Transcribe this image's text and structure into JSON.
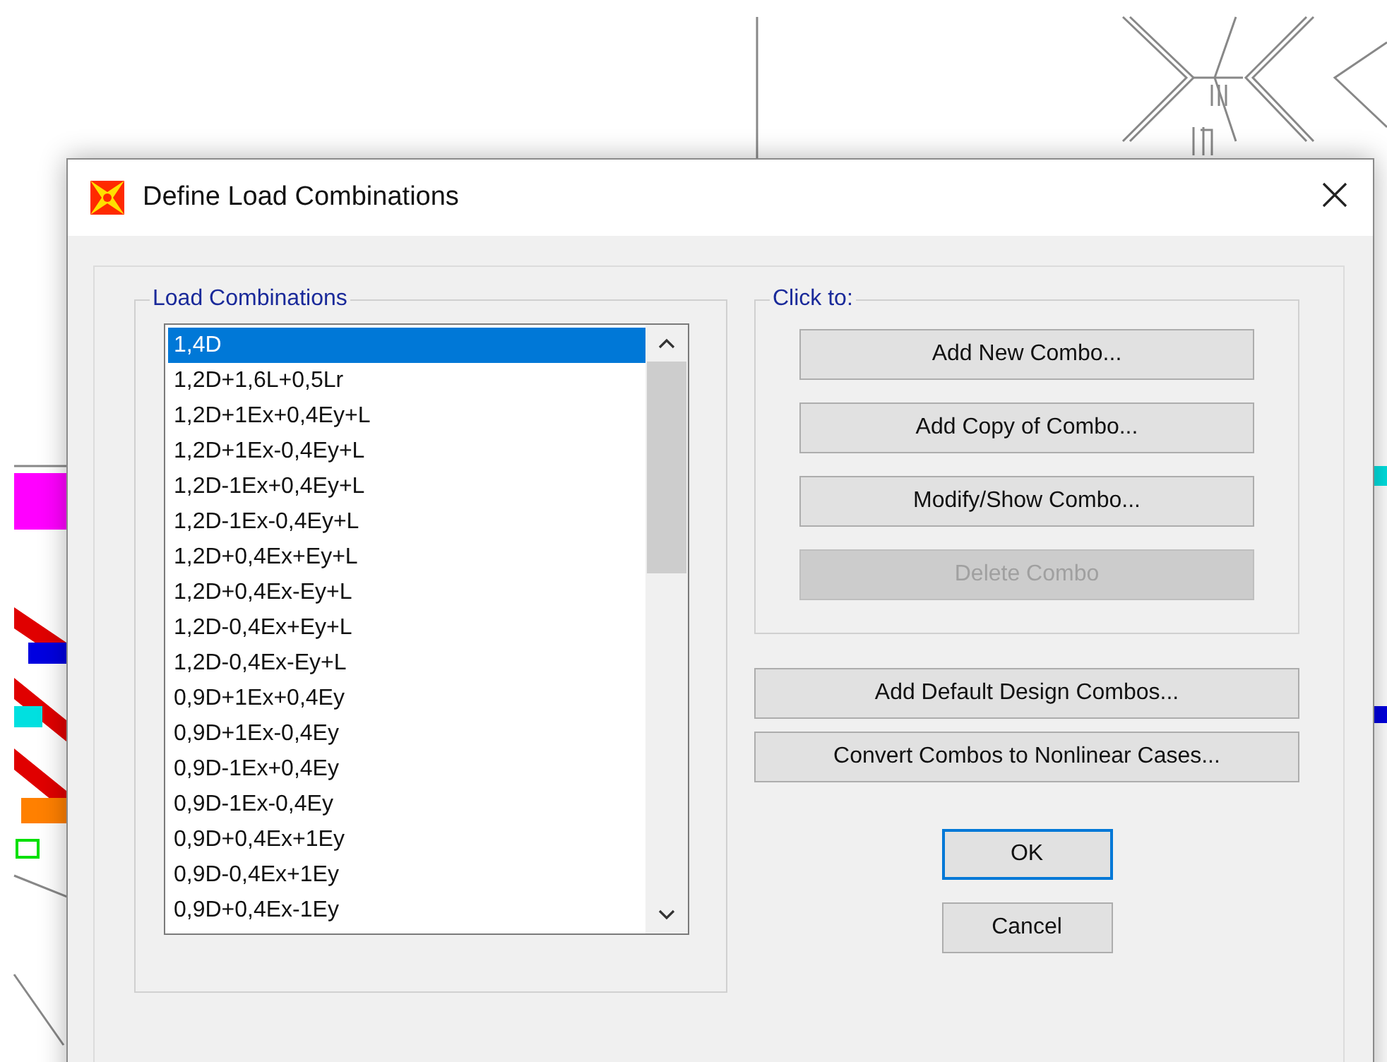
{
  "window": {
    "title": "Define Load Combinations"
  },
  "load_combinations": {
    "label": "Load Combinations",
    "items": [
      {
        "label": "1,4D",
        "selected": true
      },
      {
        "label": "1,2D+1,6L+0,5Lr",
        "selected": false
      },
      {
        "label": "1,2D+1Ex+0,4Ey+L",
        "selected": false
      },
      {
        "label": "1,2D+1Ex-0,4Ey+L",
        "selected": false
      },
      {
        "label": "1,2D-1Ex+0,4Ey+L",
        "selected": false
      },
      {
        "label": "1,2D-1Ex-0,4Ey+L",
        "selected": false
      },
      {
        "label": "1,2D+0,4Ex+Ey+L",
        "selected": false
      },
      {
        "label": "1,2D+0,4Ex-Ey+L",
        "selected": false
      },
      {
        "label": "1,2D-0,4Ex+Ey+L",
        "selected": false
      },
      {
        "label": "1,2D-0,4Ex-Ey+L",
        "selected": false
      },
      {
        "label": "0,9D+1Ex+0,4Ey",
        "selected": false
      },
      {
        "label": "0,9D+1Ex-0,4Ey",
        "selected": false
      },
      {
        "label": "0,9D-1Ex+0,4Ey",
        "selected": false
      },
      {
        "label": "0,9D-1Ex-0,4Ey",
        "selected": false
      },
      {
        "label": "0,9D+0,4Ex+1Ey",
        "selected": false
      },
      {
        "label": "0,9D-0,4Ex+1Ey",
        "selected": false
      },
      {
        "label": "0,9D+0,4Ex-1Ey",
        "selected": false
      }
    ]
  },
  "click_to": {
    "label": "Click to:",
    "buttons": [
      {
        "label": "Add New Combo...",
        "disabled": false
      },
      {
        "label": "Add Copy of Combo...",
        "disabled": false
      },
      {
        "label": "Modify/Show Combo...",
        "disabled": false
      },
      {
        "label": "Delete Combo",
        "disabled": true
      }
    ]
  },
  "extra_buttons": [
    {
      "label": "Add Default Design Combos..."
    },
    {
      "label": "Convert Combos to Nonlinear Cases..."
    }
  ],
  "dialog_buttons": [
    {
      "label": "OK",
      "kind": "default"
    },
    {
      "label": "Cancel",
      "kind": "normal"
    }
  ]
}
